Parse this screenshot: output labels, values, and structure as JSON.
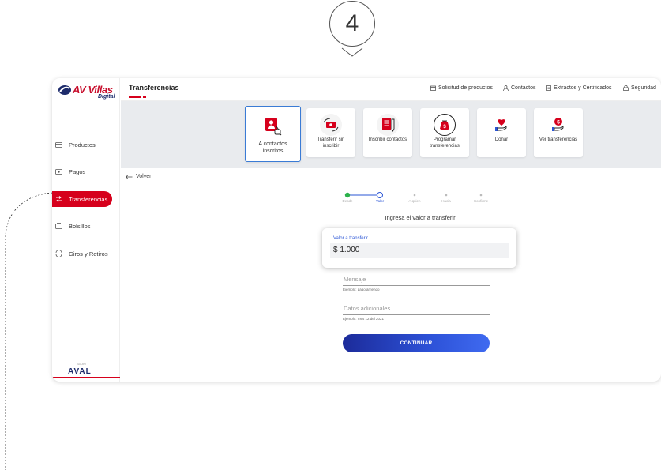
{
  "step_number": "4",
  "brand": {
    "name": "AV Villas",
    "sub": "Digital",
    "footer_logo": "AVAL",
    "footer_small": "GRUPO",
    "color": "#c8102e"
  },
  "sidebar": {
    "items": [
      {
        "label": "Productos",
        "icon": "card-icon",
        "active": false
      },
      {
        "label": "Pagos",
        "icon": "bill-icon",
        "active": false
      },
      {
        "label": "Transferencias",
        "icon": "transfer-icon",
        "active": true
      },
      {
        "label": "Bolsillos",
        "icon": "pocket-icon",
        "active": false
      },
      {
        "label": "Giros y Retiros",
        "icon": "exchange-icon",
        "active": false
      }
    ]
  },
  "topbar": {
    "title": "Transferencias",
    "links": [
      {
        "label": "Solicitud de productos",
        "icon": "calendar-icon"
      },
      {
        "label": "Contactos",
        "icon": "person-icon"
      },
      {
        "label": "Extractos y Certificados",
        "icon": "document-icon"
      },
      {
        "label": "Seguridad",
        "icon": "lock-icon"
      }
    ]
  },
  "options": [
    {
      "label": "A contactos inscritos",
      "icon": "contacts-icon",
      "selected": true
    },
    {
      "label": "Transferir sin inscribir",
      "icon": "transfer-money-icon",
      "selected": false
    },
    {
      "label": "Inscribir contactos",
      "icon": "register-icon",
      "selected": false
    },
    {
      "label": "Programar transferencias",
      "icon": "schedule-bag-icon",
      "selected": false
    },
    {
      "label": "Donar",
      "icon": "heart-hand-icon",
      "selected": false
    },
    {
      "label": "Ver transferencias",
      "icon": "coin-hand-icon",
      "selected": false
    }
  ],
  "back_label": "Volver",
  "stepper": {
    "steps": [
      "Desde",
      "Valor",
      "A quien",
      "Hacia",
      "Confirme"
    ],
    "current_index": 1
  },
  "form": {
    "title": "Ingresa el valor a transferir",
    "amount_label": "Valor a transferir",
    "amount_value": "$ 1.000",
    "message_label": "Mensaje",
    "message_hint": "Ejemplo: pago arriendo",
    "extra_label": "Datos adicionales",
    "extra_hint": "Ejemplo: mes 12 del 2021",
    "continue_label": "CONTINUAR"
  },
  "colors": {
    "accent_red": "#d6001c",
    "accent_blue": "#2a55d6",
    "band": "#e9ebee"
  }
}
